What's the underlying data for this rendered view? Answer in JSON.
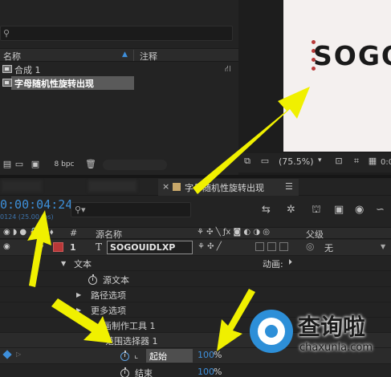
{
  "project": {
    "search_placeholder": "",
    "col_name": "名称",
    "col_comment": "注释",
    "items": [
      {
        "name": "合成 1"
      },
      {
        "name": "字母随机性旋转出现"
      }
    ],
    "bpc_label": "8 bpc"
  },
  "viewer": {
    "preview_text": "SOGO",
    "zoom_level": "(75.5%)"
  },
  "timeline": {
    "tab_name": "字母随机性旋转出现",
    "timecode": "0:00:04:24",
    "fps": "0124 (25.00 fps)",
    "search_value": "",
    "col_num": "#",
    "col_source": "源名称",
    "col_parent": "父级",
    "layer": {
      "number": "1",
      "type_glyph": "T",
      "name": "SOGOUIDLXP",
      "parent": "无",
      "color": "#b83838"
    },
    "props": {
      "text": "文本",
      "animate": "动画:",
      "source_text": "源文本",
      "path_options": "路径选项",
      "more_options": "更多选项",
      "animator": "画制作工具 1",
      "range_selector": "范围选择器 1",
      "start": "起始",
      "start_value": "100",
      "start_unit": "%",
      "end": "结束",
      "end_value": "100",
      "end_unit": "%"
    }
  },
  "watermark": {
    "title": "查询啦",
    "url": "chaxunla.com",
    "color": "#2d8fd8"
  },
  "annotations": {
    "arrow_color": "#f0f000"
  }
}
